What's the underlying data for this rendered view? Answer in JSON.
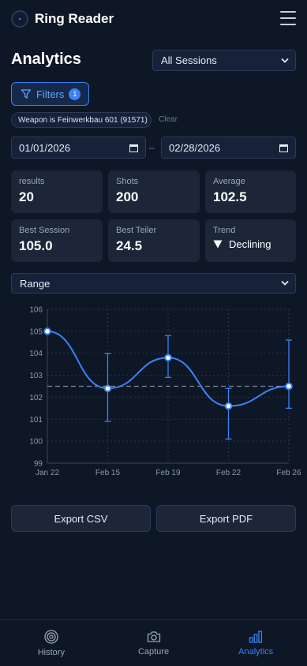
{
  "app": {
    "title": "Ring Reader"
  },
  "page": {
    "title": "Analytics"
  },
  "session_select": {
    "value": "All Sessions"
  },
  "filters": {
    "label": "Filters",
    "count": "1",
    "chip": "Weapon is Feinwerkbau 601 (91571)",
    "clear_label": "Clear"
  },
  "dates": {
    "from": "01/01/2026",
    "separator": "–",
    "to": "02/28/2026"
  },
  "stats": [
    {
      "label": "results",
      "value": "20"
    },
    {
      "label": "Shots",
      "value": "200"
    },
    {
      "label": "Average",
      "value": "102.5"
    },
    {
      "label": "Best Session",
      "value": "105.0"
    },
    {
      "label": "Best Teiler",
      "value": "24.5"
    },
    {
      "label": "Trend",
      "value": "Declining"
    }
  ],
  "range_select": {
    "value": "Range"
  },
  "chart_data": {
    "type": "line",
    "categories": [
      "Jan 22",
      "Feb 15",
      "Feb 19",
      "Feb 22",
      "Feb 26"
    ],
    "series": [
      {
        "values": [
          105.0,
          102.4,
          103.8,
          101.6,
          102.5
        ],
        "error_low": [
          105.0,
          100.9,
          102.9,
          100.1,
          101.5
        ],
        "error_high": [
          105.0,
          104.0,
          104.8,
          102.4,
          104.6
        ]
      }
    ],
    "average_line": 102.5,
    "ylim": [
      99,
      106
    ],
    "yticks": [
      "99",
      "100",
      "101",
      "102",
      "103",
      "104",
      "105",
      "106"
    ],
    "grid": true,
    "line_color": "#3b82f6"
  },
  "exports": {
    "csv_label": "Export CSV",
    "pdf_label": "Export PDF"
  },
  "nav": {
    "history_label": "History",
    "capture_label": "Capture",
    "analytics_label": "Analytics",
    "active": "Analytics"
  }
}
